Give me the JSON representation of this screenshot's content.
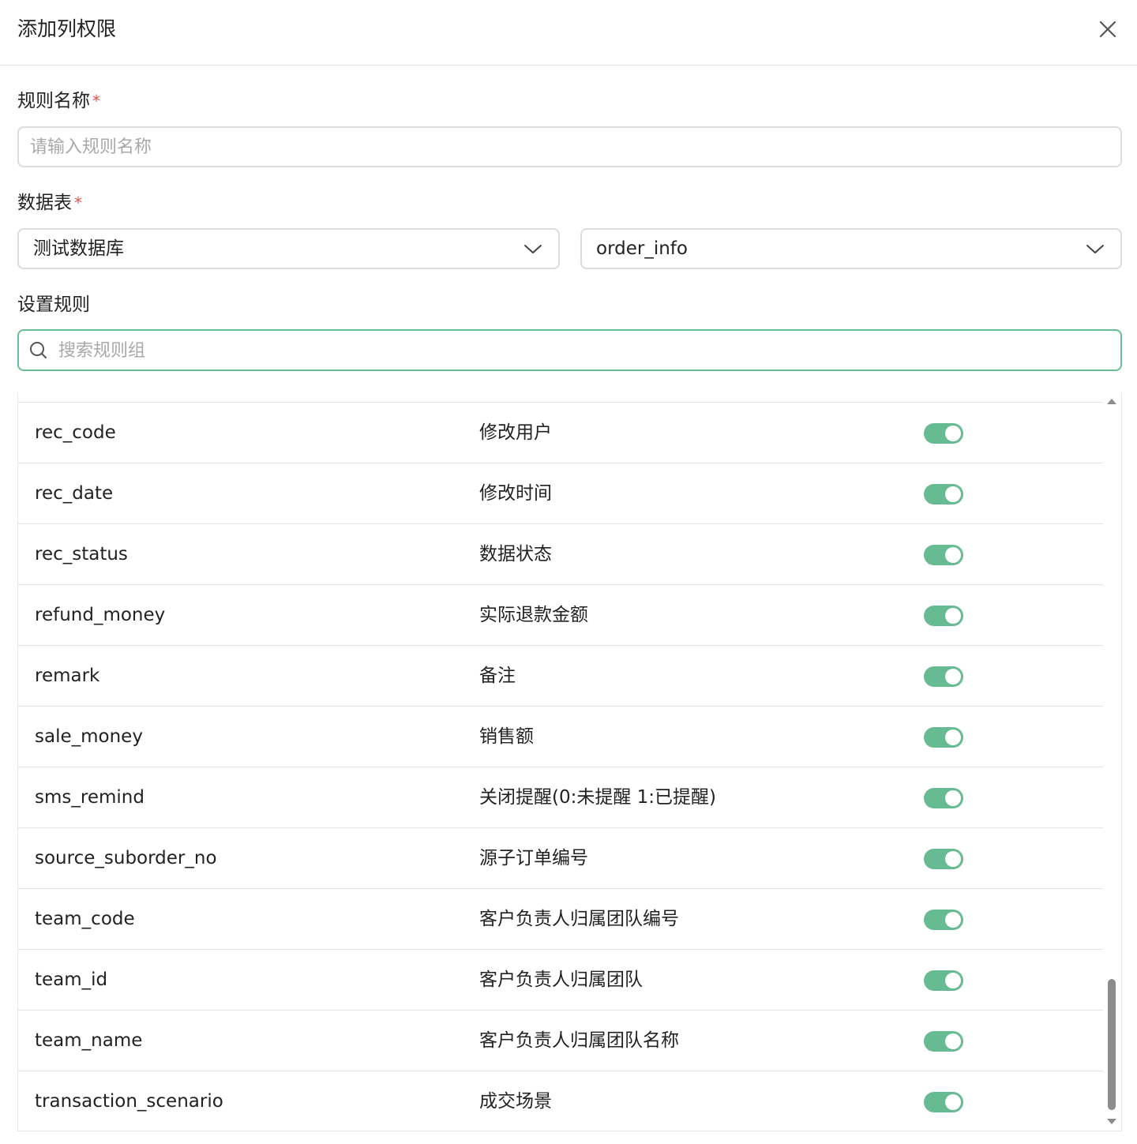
{
  "dialog": {
    "title": "添加列权限",
    "close_icon": "close-icon"
  },
  "form": {
    "rule_name_label": "规则名称",
    "rule_name_required": "*",
    "rule_name_placeholder": "请输入规则名称",
    "rule_name_value": "",
    "data_table_label": "数据表",
    "data_table_required": "*",
    "database_select": "测试数据库",
    "table_select": "order_info",
    "set_rules_label": "设置规则",
    "search_placeholder": "搜索规则组",
    "search_value": ""
  },
  "columns": [
    {
      "field": "rec_code",
      "desc": "修改用户",
      "enabled": true
    },
    {
      "field": "rec_date",
      "desc": "修改时间",
      "enabled": true
    },
    {
      "field": "rec_status",
      "desc": "数据状态",
      "enabled": true
    },
    {
      "field": "refund_money",
      "desc": "实际退款金额",
      "enabled": true
    },
    {
      "field": "remark",
      "desc": "备注",
      "enabled": true
    },
    {
      "field": "sale_money",
      "desc": "销售额",
      "enabled": true
    },
    {
      "field": "sms_remind",
      "desc": "关闭提醒(0:未提醒 1:已提醒)",
      "enabled": true
    },
    {
      "field": "source_suborder_no",
      "desc": "源子订单编号",
      "enabled": true
    },
    {
      "field": "team_code",
      "desc": "客户负责人归属团队编号",
      "enabled": true
    },
    {
      "field": "team_id",
      "desc": "客户负责人归属团队",
      "enabled": true
    },
    {
      "field": "team_name",
      "desc": "客户负责人归属团队名称",
      "enabled": true
    },
    {
      "field": "transaction_scenario",
      "desc": "成交场景",
      "enabled": true
    }
  ],
  "colors": {
    "accent": "#67bb92",
    "focus_border": "#6bbd97",
    "required": "#e0554d"
  }
}
